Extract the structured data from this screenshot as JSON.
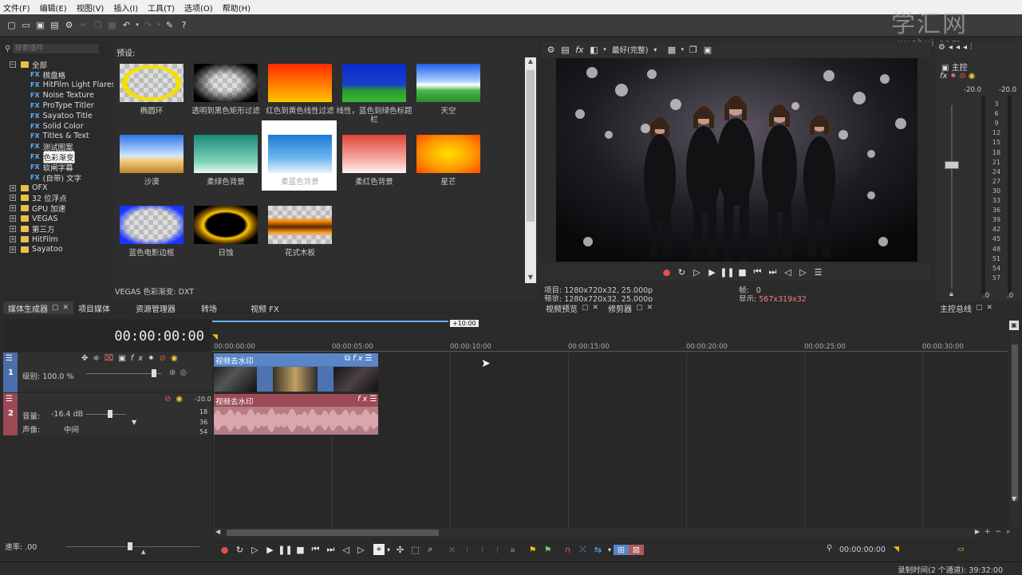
{
  "menu": [
    "文件(F)",
    "编辑(E)",
    "视图(V)",
    "插入(I)",
    "工具(T)",
    "选项(O)",
    "帮助(H)"
  ],
  "watermark": {
    "main": "学汇网",
    "sub": "xuehui.com"
  },
  "search": {
    "placeholder": "搜索插件"
  },
  "tree": {
    "root": "全部",
    "fx_items": [
      "棋盘格",
      "HitFilm Light Flares",
      "Noise Texture",
      "ProType Titler",
      "Sayatoo Title",
      "Solid Color",
      "Titles & Text",
      "测试图案",
      "色彩渐变",
      "软闸字幕",
      "(自带) 文字"
    ],
    "selected": "色彩渐变",
    "folders": [
      "OFX",
      "32 位浮点",
      "GPU 加速",
      "VEGAS",
      "第三方",
      "HitFilm",
      "Sayatoo"
    ]
  },
  "presets": {
    "heading": "预设:",
    "items": [
      "椭圆环",
      "透明到黑色矩形过滤",
      "红色到黄色线性过滤",
      "线性，蓝色到绿色标题栏",
      "天空",
      "沙漠",
      "柔绿色背景",
      "柔蓝色背景",
      "柔红色背景",
      "星芒",
      "蓝色电影边框",
      "日蚀",
      "花式木板"
    ],
    "selected": "柔蓝色背景",
    "footer": "VEGAS 色彩渐变: DXT"
  },
  "left_tabs": [
    "媒体生成器",
    "项目媒体",
    "资源管理器",
    "转场",
    "视频 FX"
  ],
  "preview": {
    "quality": "最好(完整)",
    "project_label": "项目:",
    "project": "1280x720x32, 25.000p",
    "preview_label": "预览:",
    "preview": "1280x720x32, 25.000p",
    "frame_label": "帧:",
    "frame": "0",
    "display_label": "显示:",
    "display": "567x319x32",
    "tabs": [
      "视频预览",
      "修剪器"
    ]
  },
  "mixer": {
    "title": "主控",
    "levels": [
      "-20.0",
      "-20.0"
    ],
    "scale": [
      "3",
      "6",
      "9",
      "12",
      "15",
      "18",
      "21",
      "24",
      "27",
      "30",
      "33",
      "36",
      "39",
      "42",
      "45",
      "48",
      "51",
      "54",
      "57"
    ],
    "bottom": [
      ".0",
      ".0"
    ],
    "tab": "主控总线"
  },
  "timeline": {
    "timecode": "00:00:00:00",
    "loop_label": "+10:00",
    "ticks": [
      "00:00:00:00",
      "00:00:05:00",
      "00:00:10:00",
      "00:00:15:00",
      "00:00:20:00",
      "00:00:25:00",
      "00:00:30:00"
    ],
    "track1": {
      "num": "1",
      "level_label": "级别: 100.0 %",
      "clip_name": "视频去水印"
    },
    "track2": {
      "num": "2",
      "volume_label": "音量:",
      "volume": "-16.4 dB",
      "pan_label": "声像:",
      "pan": "中间",
      "clip_name": "视频去水印",
      "meter_top": "-20.0",
      "meter_scale": [
        "18",
        "36",
        "54"
      ]
    }
  },
  "bottom": {
    "rate_label": "速率: .00",
    "timecode": "00:00:00:00"
  },
  "status": {
    "text": "录制时间(2 个通道): 39:32:00"
  }
}
